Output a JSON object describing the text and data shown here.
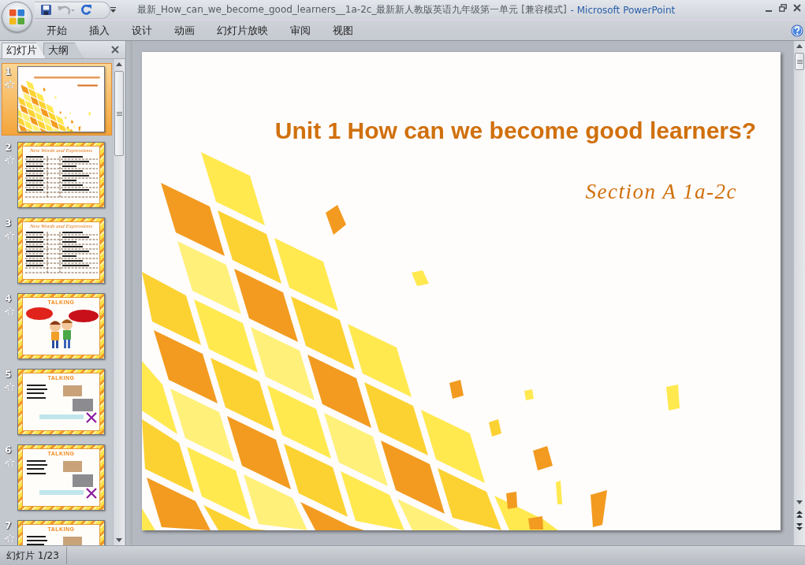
{
  "window": {
    "title": "最新_How_can_we_become_good_learners__1a-2c_最新新人教版英语九年级第一单元 [兼容模式]",
    "app_name": "- Microsoft PowerPoint"
  },
  "quick_access": [
    {
      "kind": "save",
      "disabled": false
    },
    {
      "kind": "undo",
      "disabled": true
    },
    {
      "kind": "redo",
      "disabled": false
    },
    {
      "kind": "customize",
      "disabled": false
    }
  ],
  "ribbon_tabs": [
    {
      "label": "开始",
      "selected": false
    },
    {
      "label": "插入",
      "selected": false
    },
    {
      "label": "设计",
      "selected": false
    },
    {
      "label": "动画",
      "selected": false
    },
    {
      "label": "幻灯片放映",
      "selected": false
    },
    {
      "label": "审阅",
      "selected": false
    },
    {
      "label": "视图",
      "selected": false
    }
  ],
  "pane_tabs": [
    {
      "label": "幻灯片",
      "selected": true
    },
    {
      "label": "大纲",
      "selected": false
    }
  ],
  "slides": [
    {
      "number": "1",
      "kind": "title",
      "selected": true,
      "animated": true
    },
    {
      "number": "2",
      "kind": "table",
      "title": "New Words and Expressions",
      "selected": false,
      "animated": true
    },
    {
      "number": "3",
      "kind": "table",
      "title": "New Words and Expressions",
      "selected": false,
      "animated": true
    },
    {
      "number": "4",
      "kind": "cartoon",
      "title": "TALKING",
      "selected": false,
      "animated": true
    },
    {
      "number": "5",
      "kind": "talking",
      "title": "TALKING",
      "selected": false,
      "animated": true
    },
    {
      "number": "6",
      "kind": "talking",
      "title": "TALKING",
      "selected": false,
      "animated": true
    },
    {
      "number": "7",
      "kind": "talking",
      "title": "TALKING",
      "selected": false,
      "animated": true
    }
  ],
  "slide": {
    "title": "Unit 1 How can we become good learners?",
    "subtitle": "Section A 1a-2c"
  },
  "status_bar": {
    "slide_indicator": "幻灯片 1/23"
  }
}
